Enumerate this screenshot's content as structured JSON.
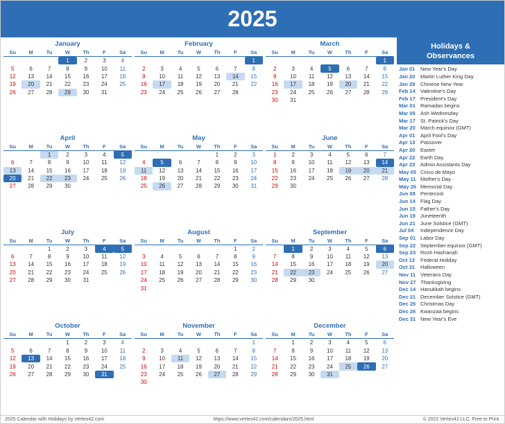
{
  "header": {
    "year": "2025"
  },
  "sidebar": {
    "title": "Holidays &\nObservances",
    "holidays": [
      {
        "date": "Jan 01",
        "name": "New Year's Day"
      },
      {
        "date": "Jan 20",
        "name": "Martin Luther King Day"
      },
      {
        "date": "Jan 29",
        "name": "Chinese New Year"
      },
      {
        "date": "Feb 14",
        "name": "Valentine's Day"
      },
      {
        "date": "Feb 17",
        "name": "President's Day"
      },
      {
        "date": "Mar 01",
        "name": "Ramadan begins"
      },
      {
        "date": "Mar 05",
        "name": "Ash Wednesday"
      },
      {
        "date": "Mar 17",
        "name": "St. Patrick's Day"
      },
      {
        "date": "Mar 20",
        "name": "March equinox (GMT)"
      },
      {
        "date": "Apr 01",
        "name": "April Fool's Day"
      },
      {
        "date": "Apr 13",
        "name": "Passover"
      },
      {
        "date": "Apr 20",
        "name": "Easter"
      },
      {
        "date": "Apr 22",
        "name": "Earth Day"
      },
      {
        "date": "Apr 23",
        "name": "Admin Assistants Day"
      },
      {
        "date": "May 05",
        "name": "Cinco de Mayo"
      },
      {
        "date": "May 11",
        "name": "Mother's Day"
      },
      {
        "date": "May 26",
        "name": "Memorial Day"
      },
      {
        "date": "Jun 08",
        "name": "Pentecost"
      },
      {
        "date": "Jun 14",
        "name": "Flag Day"
      },
      {
        "date": "Jun 15",
        "name": "Father's Day"
      },
      {
        "date": "Jun 19",
        "name": "Juneteenth"
      },
      {
        "date": "Jun 21",
        "name": "June Solstice (GMT)"
      },
      {
        "date": "Jul 04",
        "name": "Independence Day"
      },
      {
        "date": "Sep 01",
        "name": "Labor Day"
      },
      {
        "date": "Sep 22",
        "name": "September equinox (GMT)"
      },
      {
        "date": "Sep 23",
        "name": "Rosh Hashanah"
      },
      {
        "date": "Oct 13",
        "name": "Federal Holiday"
      },
      {
        "date": "Oct 31",
        "name": "Halloween"
      },
      {
        "date": "Nov 11",
        "name": "Veterans Day"
      },
      {
        "date": "Nov 27",
        "name": "Thanksgiving"
      },
      {
        "date": "Dec 14",
        "name": "Hanukkah begins"
      },
      {
        "date": "Dec 21",
        "name": "December Solstice (GMT)"
      },
      {
        "date": "Dec 25",
        "name": "Christmas Day"
      },
      {
        "date": "Dec 26",
        "name": "Kwanzaa begins"
      },
      {
        "date": "Dec 31",
        "name": "New Year's Eve"
      }
    ]
  },
  "footer": {
    "left": "2025 Calendar with Holidays by Vertex42.com",
    "center": "https://www.vertex42.com/calendars/2025.html",
    "right": "© 2022 Vertex42 LLC. Free to Print."
  },
  "months": [
    {
      "name": "January",
      "days": [
        [
          null,
          null,
          null,
          1,
          2,
          3,
          4
        ],
        [
          5,
          6,
          7,
          8,
          9,
          10,
          11
        ],
        [
          12,
          13,
          14,
          15,
          16,
          17,
          18
        ],
        [
          19,
          20,
          21,
          22,
          23,
          24,
          25
        ],
        [
          26,
          27,
          28,
          29,
          30,
          31,
          null
        ]
      ],
      "highlights": {
        "1": "blue",
        "20": "light",
        "29": "light"
      }
    },
    {
      "name": "February",
      "days": [
        [
          null,
          null,
          null,
          null,
          null,
          null,
          1
        ],
        [
          2,
          3,
          4,
          5,
          6,
          7,
          8
        ],
        [
          9,
          10,
          11,
          12,
          13,
          14,
          15
        ],
        [
          16,
          17,
          18,
          19,
          20,
          21,
          22
        ],
        [
          23,
          24,
          25,
          26,
          27,
          28,
          null
        ]
      ],
      "highlights": {
        "1": "blue",
        "14": "light",
        "17": "light"
      }
    },
    {
      "name": "March",
      "days": [
        [
          null,
          null,
          null,
          null,
          null,
          null,
          1
        ],
        [
          2,
          3,
          4,
          5,
          6,
          7,
          8
        ],
        [
          9,
          10,
          11,
          12,
          13,
          14,
          15
        ],
        [
          16,
          17,
          18,
          19,
          20,
          21,
          22
        ],
        [
          23,
          24,
          25,
          26,
          27,
          28,
          29
        ],
        [
          30,
          31,
          null,
          null,
          null,
          null,
          null
        ]
      ],
      "highlights": {
        "1": "blue",
        "5": "blue",
        "17": "light",
        "20": "light"
      }
    },
    {
      "name": "April",
      "days": [
        [
          null,
          null,
          1,
          2,
          3,
          4,
          5
        ],
        [
          6,
          7,
          8,
          9,
          10,
          11,
          12
        ],
        [
          13,
          14,
          15,
          16,
          17,
          18,
          19
        ],
        [
          20,
          21,
          22,
          23,
          24,
          25,
          26
        ],
        [
          27,
          28,
          29,
          30,
          null,
          null,
          null
        ]
      ],
      "highlights": {
        "1": "light",
        "5": "blue",
        "13": "light",
        "20": "blue",
        "22": "light",
        "23": "light"
      }
    },
    {
      "name": "May",
      "days": [
        [
          null,
          null,
          null,
          null,
          1,
          2,
          3
        ],
        [
          4,
          5,
          6,
          7,
          8,
          9,
          10
        ],
        [
          11,
          12,
          13,
          14,
          15,
          16,
          17
        ],
        [
          18,
          19,
          20,
          21,
          22,
          23,
          24
        ],
        [
          25,
          26,
          27,
          28,
          29,
          30,
          31
        ]
      ],
      "highlights": {
        "5": "blue",
        "11": "light",
        "26": "light"
      }
    },
    {
      "name": "June",
      "days": [
        [
          1,
          2,
          3,
          4,
          5,
          6,
          7
        ],
        [
          8,
          9,
          10,
          11,
          12,
          13,
          14
        ],
        [
          15,
          16,
          17,
          18,
          19,
          20,
          21
        ],
        [
          22,
          23,
          24,
          25,
          26,
          27,
          28
        ],
        [
          29,
          30,
          null,
          null,
          null,
          null,
          null
        ]
      ],
      "highlights": {
        "14": "blue",
        "19": "light",
        "20": "light",
        "21": "light"
      }
    },
    {
      "name": "July",
      "days": [
        [
          null,
          null,
          1,
          2,
          3,
          4,
          5
        ],
        [
          6,
          7,
          8,
          9,
          10,
          11,
          12
        ],
        [
          13,
          14,
          15,
          16,
          17,
          18,
          19
        ],
        [
          20,
          21,
          22,
          23,
          24,
          25,
          26
        ],
        [
          27,
          28,
          29,
          30,
          31,
          null,
          null
        ]
      ],
      "highlights": {
        "4": "blue",
        "5": "blue"
      }
    },
    {
      "name": "August",
      "days": [
        [
          null,
          null,
          null,
          null,
          null,
          1,
          2
        ],
        [
          3,
          4,
          5,
          6,
          7,
          8,
          9
        ],
        [
          10,
          11,
          12,
          13,
          14,
          15,
          16
        ],
        [
          17,
          18,
          19,
          20,
          21,
          22,
          23
        ],
        [
          24,
          25,
          26,
          27,
          28,
          29,
          30
        ],
        [
          31,
          null,
          null,
          null,
          null,
          null,
          null
        ]
      ],
      "highlights": {}
    },
    {
      "name": "September",
      "days": [
        [
          null,
          1,
          2,
          3,
          4,
          5,
          6
        ],
        [
          7,
          8,
          9,
          10,
          11,
          12,
          13
        ],
        [
          14,
          15,
          16,
          17,
          18,
          19,
          20
        ],
        [
          21,
          22,
          23,
          24,
          25,
          26,
          27
        ],
        [
          28,
          29,
          30,
          null,
          null,
          null,
          null
        ]
      ],
      "highlights": {
        "1": "blue",
        "6": "blue",
        "20": "light",
        "22": "light",
        "23": "light"
      }
    },
    {
      "name": "October",
      "days": [
        [
          null,
          null,
          null,
          1,
          2,
          3,
          4
        ],
        [
          5,
          6,
          7,
          8,
          9,
          10,
          11
        ],
        [
          12,
          13,
          14,
          15,
          16,
          17,
          18
        ],
        [
          19,
          20,
          21,
          22,
          23,
          24,
          25
        ],
        [
          26,
          27,
          28,
          29,
          30,
          31,
          null
        ]
      ],
      "highlights": {
        "13": "blue",
        "31": "blue"
      }
    },
    {
      "name": "November",
      "days": [
        [
          null,
          null,
          null,
          null,
          null,
          null,
          1
        ],
        [
          2,
          3,
          4,
          5,
          6,
          7,
          8
        ],
        [
          9,
          10,
          11,
          12,
          13,
          14,
          15
        ],
        [
          16,
          17,
          18,
          19,
          20,
          21,
          22
        ],
        [
          23,
          24,
          25,
          26,
          27,
          28,
          29
        ],
        [
          30,
          null,
          null,
          null,
          null,
          null,
          null
        ]
      ],
      "highlights": {
        "11": "light",
        "27": "light",
        "27b": "light"
      }
    },
    {
      "name": "December",
      "days": [
        [
          null,
          1,
          2,
          3,
          4,
          5,
          6
        ],
        [
          7,
          8,
          9,
          10,
          11,
          12,
          13
        ],
        [
          14,
          15,
          16,
          17,
          18,
          19,
          20
        ],
        [
          21,
          22,
          23,
          24,
          25,
          26,
          27
        ],
        [
          28,
          29,
          30,
          31,
          null,
          null,
          null
        ]
      ],
      "highlights": {
        "25": "light",
        "26": "blue",
        "31": "light"
      }
    }
  ]
}
